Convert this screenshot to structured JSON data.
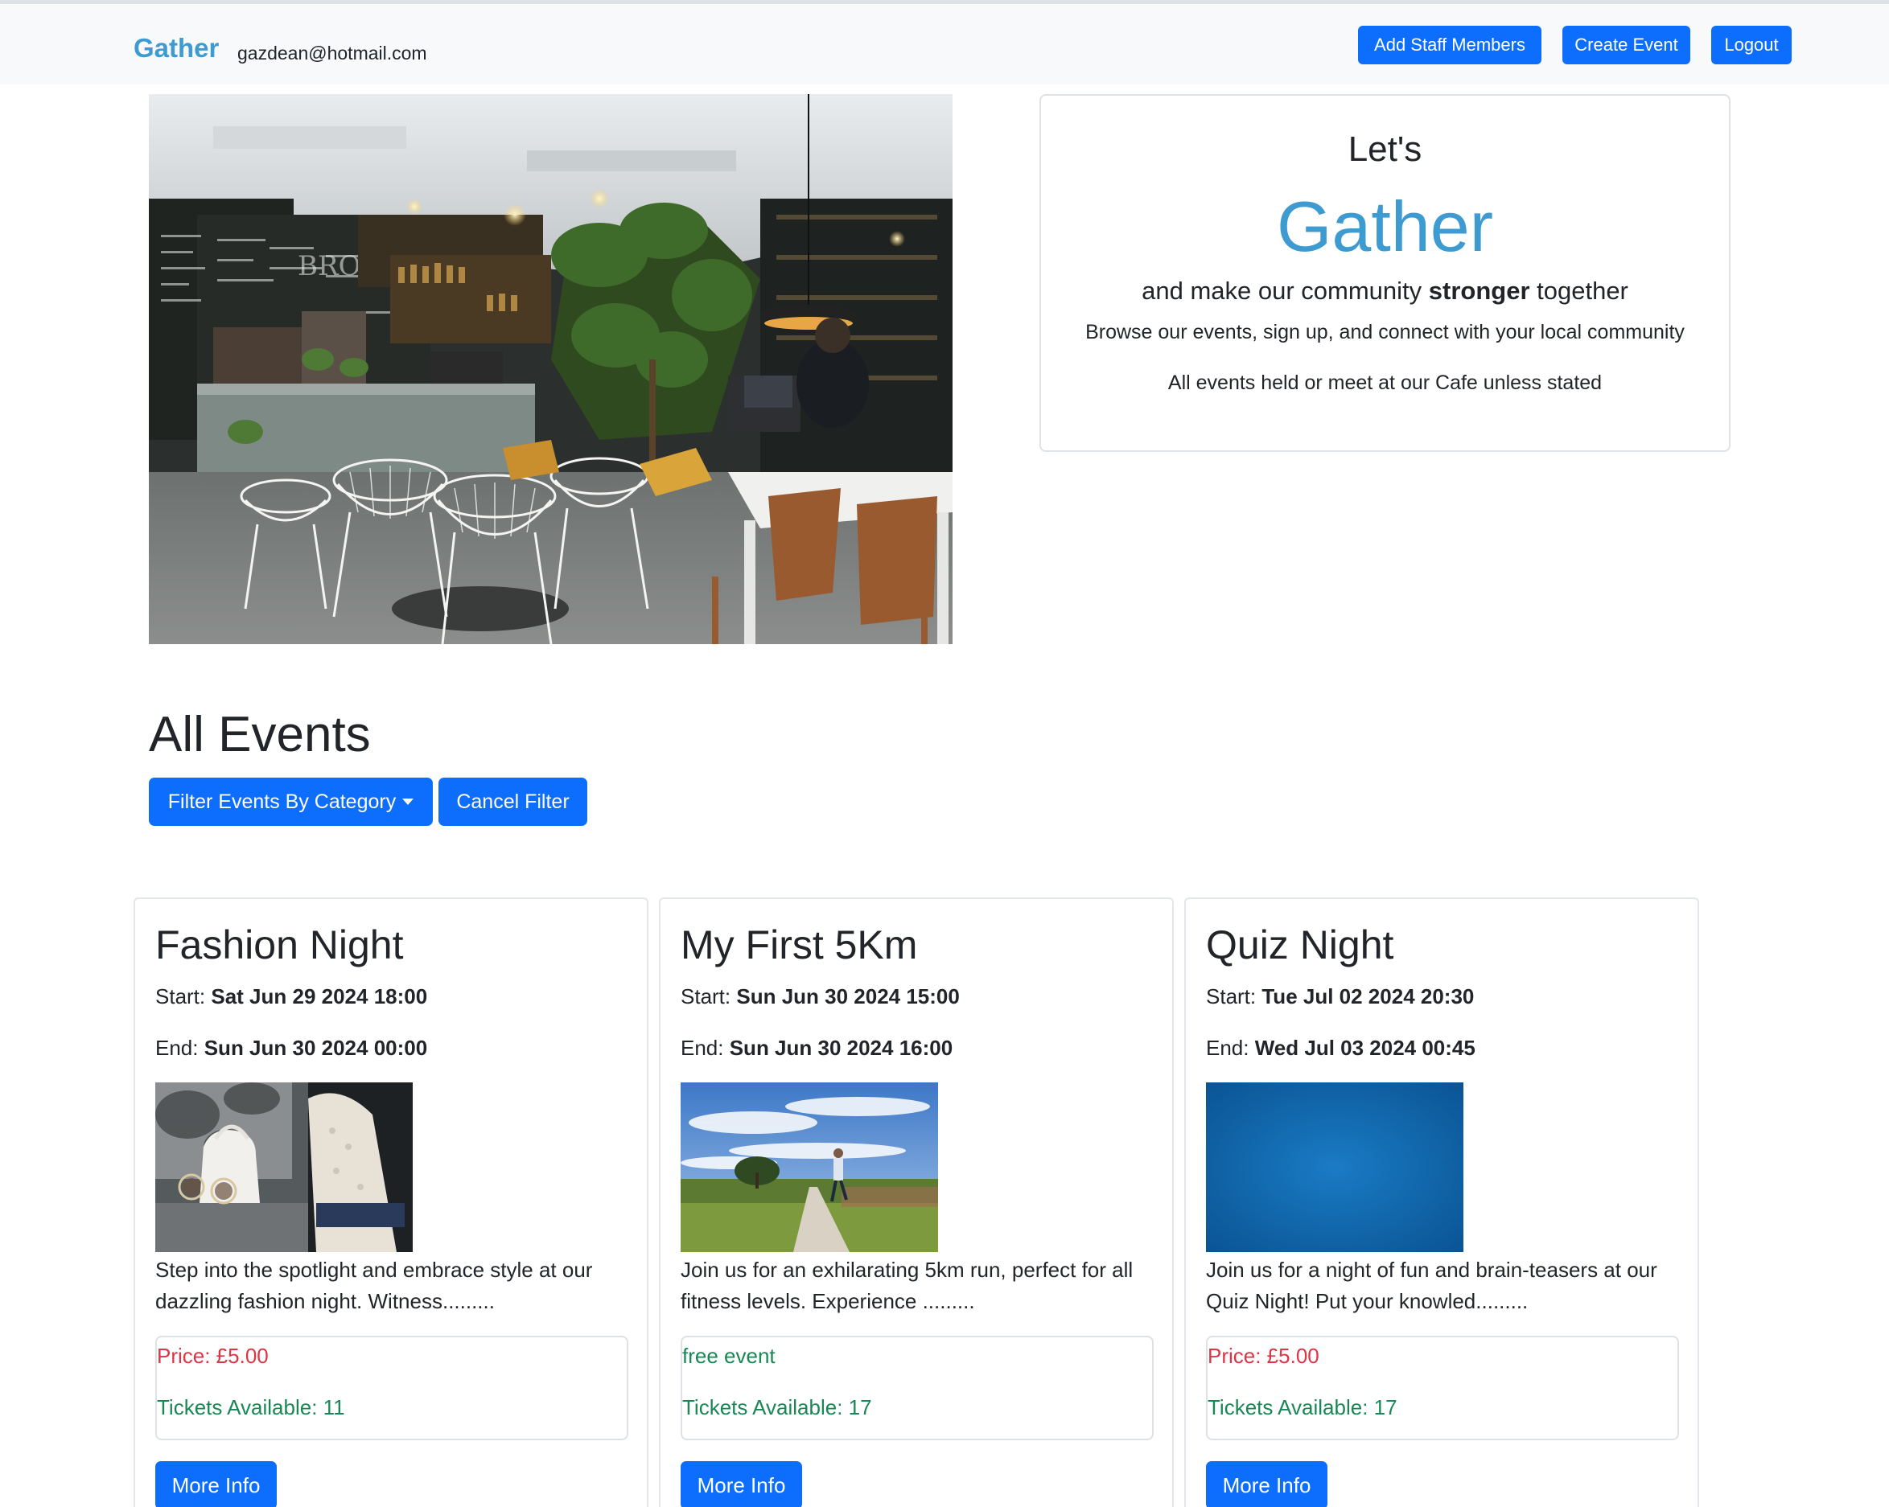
{
  "navbar": {
    "brand": "Gather",
    "user_email": "gazdean@hotmail.com",
    "buttons": {
      "add_staff": "Add Staff Members",
      "create_event": "Create Event",
      "logout": "Logout"
    }
  },
  "intro": {
    "lets": "Let's",
    "brand": "Gather",
    "tagline_pre": "and make our community ",
    "tagline_bold": "stronger",
    "tagline_post": " together",
    "description": "Browse our events, sign up, and connect with your local community",
    "note": "All events held or meet at our Cafe unless stated"
  },
  "events_section": {
    "title": "All Events",
    "filter_label": "Filter Events By Category",
    "cancel_label": "Cancel Filter"
  },
  "colors": {
    "brand": "#3d9bd1",
    "primary": "#0d6efd",
    "price": "#dc3545",
    "available": "#198754"
  },
  "events": [
    {
      "title": "Fashion Night",
      "start_label": "Start: ",
      "start": "Sat Jun 29 2024 18:00",
      "end_label": "End: ",
      "end": "Sun Jun 30 2024 00:00",
      "description": "Step into the spotlight and embrace style at our dazzling fashion night. Witness.........",
      "price_text": "Price: £5.00",
      "price_color": "#dc3545",
      "tickets": "Tickets Available: 11",
      "more": "More Info"
    },
    {
      "title": "My First 5Km",
      "start_label": "Start: ",
      "start": "Sun Jun 30 2024 15:00",
      "end_label": "End: ",
      "end": "Sun Jun 30 2024 16:00",
      "description": "Join us for an exhilarating 5km run, perfect for all fitness levels. Experience .........",
      "price_text": "free event",
      "price_color": "#198754",
      "tickets": "Tickets Available: 17",
      "more": "More Info"
    },
    {
      "title": "Quiz Night",
      "start_label": "Start: ",
      "start": "Tue Jul 02 2024 20:30",
      "end_label": "End: ",
      "end": "Wed Jul 03 2024 00:45",
      "description": "Join us for a night of fun and brain-teasers at our Quiz Night! Put your knowled.........",
      "price_text": "Price: £5.00",
      "price_color": "#dc3545",
      "tickets": "Tickets Available: 17",
      "more": "More Info"
    }
  ]
}
